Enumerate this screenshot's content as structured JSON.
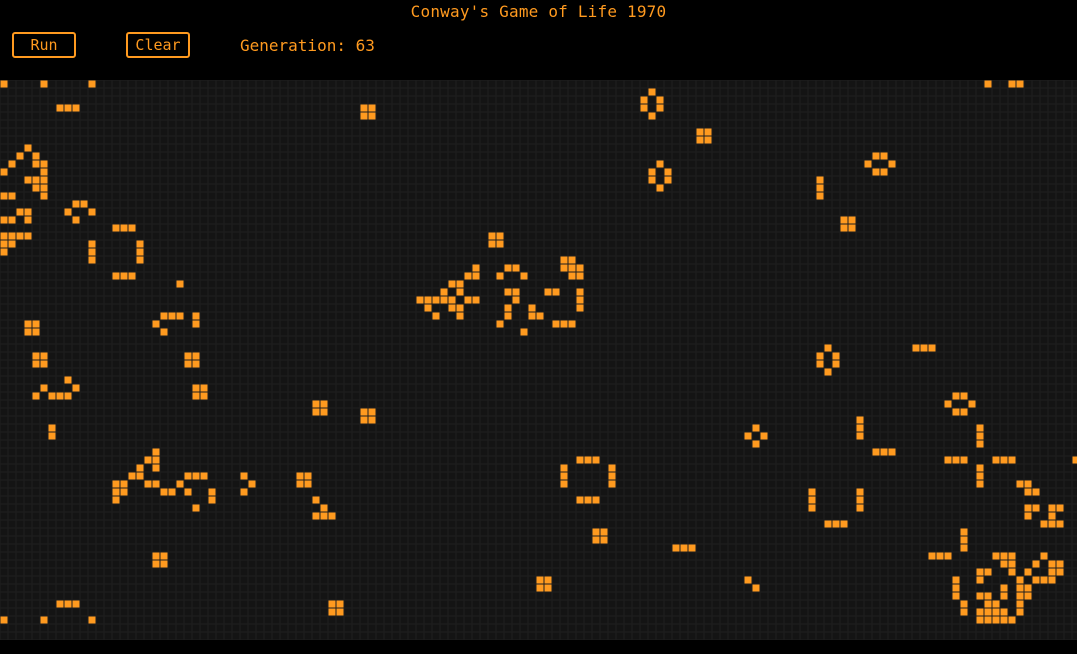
{
  "title": "Conway's Game of Life 1970",
  "controls": {
    "run_label": "Run",
    "clear_label": "Clear",
    "generation_label": "Generation: 63"
  },
  "colors": {
    "background": "#000000",
    "accent": "#ff9a1f",
    "cell_alive": "#ff9a1f",
    "cell_dead": "#141414",
    "grid_line": "#1f1f1f"
  },
  "board": {
    "live_cells": [
      [
        0,
        0
      ],
      [
        5,
        0
      ],
      [
        11,
        0
      ],
      [
        123,
        0
      ],
      [
        126,
        0
      ],
      [
        127,
        0
      ],
      [
        7,
        3
      ],
      [
        8,
        3
      ],
      [
        9,
        3
      ],
      [
        45,
        3
      ],
      [
        46,
        3
      ],
      [
        81,
        1
      ],
      [
        80,
        2
      ],
      [
        82,
        2
      ],
      [
        80,
        3
      ],
      [
        82,
        3
      ],
      [
        81,
        4
      ],
      [
        45,
        4
      ],
      [
        46,
        4
      ],
      [
        87,
        6
      ],
      [
        88,
        6
      ],
      [
        87,
        7
      ],
      [
        88,
        7
      ],
      [
        3,
        8
      ],
      [
        2,
        9
      ],
      [
        4,
        9
      ],
      [
        109,
        9
      ],
      [
        110,
        9
      ],
      [
        108,
        10
      ],
      [
        111,
        10
      ],
      [
        109,
        11
      ],
      [
        110,
        11
      ],
      [
        1,
        10
      ],
      [
        4,
        10
      ],
      [
        5,
        10
      ],
      [
        0,
        11
      ],
      [
        5,
        11
      ],
      [
        82,
        10
      ],
      [
        81,
        11
      ],
      [
        83,
        11
      ],
      [
        81,
        12
      ],
      [
        83,
        12
      ],
      [
        82,
        13
      ],
      [
        3,
        12
      ],
      [
        4,
        12
      ],
      [
        5,
        12
      ],
      [
        102,
        12
      ],
      [
        102,
        13
      ],
      [
        102,
        14
      ],
      [
        4,
        13
      ],
      [
        5,
        13
      ],
      [
        0,
        14
      ],
      [
        1,
        14
      ],
      [
        5,
        14
      ],
      [
        9,
        15
      ],
      [
        10,
        15
      ],
      [
        8,
        16
      ],
      [
        11,
        16
      ],
      [
        9,
        17
      ],
      [
        105,
        17
      ],
      [
        106,
        17
      ],
      [
        105,
        18
      ],
      [
        106,
        18
      ],
      [
        2,
        16
      ],
      [
        3,
        16
      ],
      [
        0,
        17
      ],
      [
        1,
        17
      ],
      [
        3,
        17
      ],
      [
        14,
        18
      ],
      [
        15,
        18
      ],
      [
        16,
        18
      ],
      [
        0,
        19
      ],
      [
        1,
        19
      ],
      [
        2,
        19
      ],
      [
        3,
        19
      ],
      [
        61,
        19
      ],
      [
        62,
        19
      ],
      [
        61,
        20
      ],
      [
        62,
        20
      ],
      [
        0,
        20
      ],
      [
        1,
        20
      ],
      [
        11,
        20
      ],
      [
        17,
        20
      ],
      [
        11,
        21
      ],
      [
        17,
        21
      ],
      [
        11,
        22
      ],
      [
        17,
        22
      ],
      [
        0,
        21
      ],
      [
        70,
        22
      ],
      [
        71,
        22
      ],
      [
        70,
        23
      ],
      [
        71,
        23
      ],
      [
        72,
        23
      ],
      [
        59,
        23
      ],
      [
        58,
        24
      ],
      [
        59,
        24
      ],
      [
        63,
        23
      ],
      [
        64,
        23
      ],
      [
        62,
        24
      ],
      [
        65,
        24
      ],
      [
        71,
        24
      ],
      [
        72,
        24
      ],
      [
        14,
        24
      ],
      [
        15,
        24
      ],
      [
        16,
        24
      ],
      [
        22,
        25
      ],
      [
        56,
        25
      ],
      [
        57,
        25
      ],
      [
        55,
        26
      ],
      [
        57,
        26
      ],
      [
        63,
        26
      ],
      [
        64,
        26
      ],
      [
        68,
        26
      ],
      [
        69,
        26
      ],
      [
        72,
        26
      ],
      [
        55,
        27
      ],
      [
        56,
        27
      ],
      [
        58,
        27
      ],
      [
        59,
        27
      ],
      [
        64,
        27
      ],
      [
        72,
        27
      ],
      [
        52,
        27
      ],
      [
        53,
        27
      ],
      [
        54,
        27
      ],
      [
        53,
        28
      ],
      [
        56,
        28
      ],
      [
        57,
        28
      ],
      [
        63,
        28
      ],
      [
        66,
        28
      ],
      [
        72,
        28
      ],
      [
        20,
        29
      ],
      [
        21,
        29
      ],
      [
        22,
        29
      ],
      [
        24,
        29
      ],
      [
        54,
        29
      ],
      [
        57,
        29
      ],
      [
        63,
        29
      ],
      [
        66,
        29
      ],
      [
        67,
        29
      ],
      [
        19,
        30
      ],
      [
        24,
        30
      ],
      [
        3,
        30
      ],
      [
        4,
        30
      ],
      [
        3,
        31
      ],
      [
        4,
        31
      ],
      [
        62,
        30
      ],
      [
        69,
        30
      ],
      [
        70,
        30
      ],
      [
        71,
        30
      ],
      [
        20,
        31
      ],
      [
        65,
        31
      ],
      [
        114,
        33
      ],
      [
        115,
        33
      ],
      [
        116,
        33
      ],
      [
        103,
        33
      ],
      [
        102,
        34
      ],
      [
        104,
        34
      ],
      [
        102,
        35
      ],
      [
        104,
        35
      ],
      [
        103,
        36
      ],
      [
        4,
        34
      ],
      [
        5,
        34
      ],
      [
        4,
        35
      ],
      [
        5,
        35
      ],
      [
        23,
        34
      ],
      [
        24,
        34
      ],
      [
        23,
        35
      ],
      [
        24,
        35
      ],
      [
        8,
        37
      ],
      [
        5,
        38
      ],
      [
        9,
        38
      ],
      [
        4,
        39
      ],
      [
        6,
        39
      ],
      [
        7,
        39
      ],
      [
        8,
        39
      ],
      [
        24,
        38
      ],
      [
        25,
        38
      ],
      [
        24,
        39
      ],
      [
        25,
        39
      ],
      [
        119,
        39
      ],
      [
        120,
        39
      ],
      [
        118,
        40
      ],
      [
        121,
        40
      ],
      [
        119,
        41
      ],
      [
        120,
        41
      ],
      [
        39,
        40
      ],
      [
        40,
        40
      ],
      [
        39,
        41
      ],
      [
        40,
        41
      ],
      [
        45,
        41
      ],
      [
        46,
        41
      ],
      [
        45,
        42
      ],
      [
        46,
        42
      ],
      [
        107,
        42
      ],
      [
        107,
        43
      ],
      [
        107,
        44
      ],
      [
        122,
        43
      ],
      [
        122,
        44
      ],
      [
        122,
        45
      ],
      [
        6,
        43
      ],
      [
        6,
        44
      ],
      [
        94,
        43
      ],
      [
        93,
        44
      ],
      [
        95,
        44
      ],
      [
        94,
        45
      ],
      [
        109,
        46
      ],
      [
        110,
        46
      ],
      [
        111,
        46
      ],
      [
        19,
        46
      ],
      [
        18,
        47
      ],
      [
        19,
        47
      ],
      [
        72,
        47
      ],
      [
        73,
        47
      ],
      [
        74,
        47
      ],
      [
        118,
        47
      ],
      [
        119,
        47
      ],
      [
        120,
        47
      ],
      [
        124,
        47
      ],
      [
        125,
        47
      ],
      [
        126,
        47
      ],
      [
        134,
        47
      ],
      [
        17,
        48
      ],
      [
        19,
        48
      ],
      [
        70,
        48
      ],
      [
        76,
        48
      ],
      [
        122,
        48
      ],
      [
        16,
        49
      ],
      [
        17,
        49
      ],
      [
        23,
        49
      ],
      [
        24,
        49
      ],
      [
        25,
        49
      ],
      [
        30,
        49
      ],
      [
        37,
        49
      ],
      [
        38,
        49
      ],
      [
        70,
        49
      ],
      [
        76,
        49
      ],
      [
        122,
        49
      ],
      [
        14,
        50
      ],
      [
        15,
        50
      ],
      [
        18,
        50
      ],
      [
        19,
        50
      ],
      [
        22,
        50
      ],
      [
        31,
        50
      ],
      [
        37,
        50
      ],
      [
        38,
        50
      ],
      [
        70,
        50
      ],
      [
        76,
        50
      ],
      [
        122,
        50
      ],
      [
        127,
        50
      ],
      [
        128,
        50
      ],
      [
        14,
        51
      ],
      [
        15,
        51
      ],
      [
        20,
        51
      ],
      [
        21,
        51
      ],
      [
        23,
        51
      ],
      [
        26,
        51
      ],
      [
        30,
        51
      ],
      [
        101,
        51
      ],
      [
        107,
        51
      ],
      [
        128,
        51
      ],
      [
        129,
        51
      ],
      [
        14,
        52
      ],
      [
        26,
        52
      ],
      [
        39,
        52
      ],
      [
        72,
        52
      ],
      [
        73,
        52
      ],
      [
        74,
        52
      ],
      [
        101,
        52
      ],
      [
        107,
        52
      ],
      [
        24,
        53
      ],
      [
        40,
        53
      ],
      [
        101,
        53
      ],
      [
        107,
        53
      ],
      [
        128,
        53
      ],
      [
        129,
        53
      ],
      [
        131,
        53
      ],
      [
        132,
        53
      ],
      [
        39,
        54
      ],
      [
        40,
        54
      ],
      [
        41,
        54
      ],
      [
        128,
        54
      ],
      [
        131,
        54
      ],
      [
        103,
        55
      ],
      [
        104,
        55
      ],
      [
        105,
        55
      ],
      [
        130,
        55
      ],
      [
        131,
        55
      ],
      [
        132,
        55
      ],
      [
        74,
        56
      ],
      [
        75,
        56
      ],
      [
        120,
        56
      ],
      [
        74,
        57
      ],
      [
        75,
        57
      ],
      [
        120,
        57
      ],
      [
        84,
        58
      ],
      [
        85,
        58
      ],
      [
        86,
        58
      ],
      [
        120,
        58
      ],
      [
        19,
        59
      ],
      [
        20,
        59
      ],
      [
        116,
        59
      ],
      [
        117,
        59
      ],
      [
        118,
        59
      ],
      [
        124,
        59
      ],
      [
        125,
        59
      ],
      [
        126,
        59
      ],
      [
        130,
        59
      ],
      [
        19,
        60
      ],
      [
        20,
        60
      ],
      [
        125,
        60
      ],
      [
        126,
        60
      ],
      [
        129,
        60
      ],
      [
        131,
        60
      ],
      [
        132,
        60
      ],
      [
        122,
        61
      ],
      [
        123,
        61
      ],
      [
        126,
        61
      ],
      [
        128,
        61
      ],
      [
        131,
        61
      ],
      [
        132,
        61
      ],
      [
        67,
        62
      ],
      [
        68,
        62
      ],
      [
        93,
        62
      ],
      [
        119,
        62
      ],
      [
        122,
        62
      ],
      [
        127,
        62
      ],
      [
        129,
        62
      ],
      [
        130,
        62
      ],
      [
        131,
        62
      ],
      [
        67,
        63
      ],
      [
        68,
        63
      ],
      [
        94,
        63
      ],
      [
        119,
        63
      ],
      [
        125,
        63
      ],
      [
        127,
        63
      ],
      [
        128,
        63
      ],
      [
        119,
        64
      ],
      [
        122,
        64
      ],
      [
        123,
        64
      ],
      [
        125,
        64
      ],
      [
        127,
        64
      ],
      [
        128,
        64
      ],
      [
        7,
        65
      ],
      [
        8,
        65
      ],
      [
        9,
        65
      ],
      [
        41,
        65
      ],
      [
        42,
        65
      ],
      [
        120,
        65
      ],
      [
        123,
        65
      ],
      [
        124,
        65
      ],
      [
        127,
        65
      ],
      [
        41,
        66
      ],
      [
        42,
        66
      ],
      [
        120,
        66
      ],
      [
        122,
        66
      ],
      [
        123,
        66
      ],
      [
        124,
        66
      ],
      [
        125,
        66
      ],
      [
        127,
        66
      ],
      [
        0,
        67
      ],
      [
        5,
        67
      ],
      [
        11,
        67
      ],
      [
        122,
        67
      ],
      [
        123,
        67
      ],
      [
        124,
        67
      ],
      [
        125,
        67
      ],
      [
        126,
        67
      ]
    ]
  }
}
